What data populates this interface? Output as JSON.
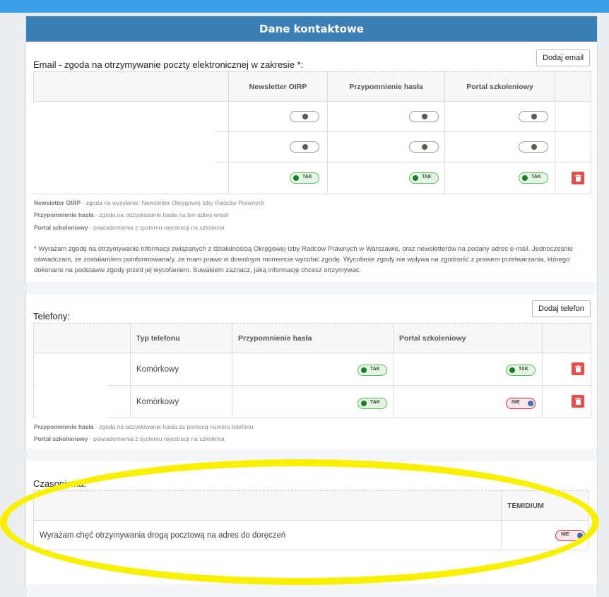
{
  "panel": {
    "title": "Dane kontaktowe"
  },
  "email": {
    "label": "Email - zgoda na otrzymywanie poczty elektronicznej w zakresie *:",
    "add_button": "Dodaj email",
    "columns": [
      "Newsletter OIRP",
      "Przypomnienie hasła",
      "Portal szkoleniowy"
    ],
    "rows": [
      {
        "newsletter": "off",
        "password": "off",
        "portal": "off"
      },
      {
        "newsletter": "off",
        "password": "off",
        "portal": "off"
      },
      {
        "newsletter": "TAK",
        "password": "TAK",
        "portal": "TAK"
      }
    ],
    "legend": [
      {
        "term": "Newsletter OIRP",
        "desc": " - zgoda na wysyłanie: Newsletter Okręgowej Izby Radców Prawnych"
      },
      {
        "term": "Przypomnienie hasła",
        "desc": " - zgoda na odzyskiwanie hasła na ten adres email"
      },
      {
        "term": "Portal szkoleniowy",
        "desc": " - powiadomienia z systemu rejestracji na szkolenia"
      }
    ],
    "note": "* Wyrażam zgodę na otrzymywanie informacji związanych z działalnością Okręgowej Izby Radców Prawnych w Warszawie, oraz newsletterów na podany adres e-mail. Jednocześnie oświadczam, że zostałam/em poinformowana/y, że mam prawo w dowolnym momencie wycofać zgodę. Wycofanie zgody nie wpływa na zgodność z prawem przetwarzania, którego dokonano na podstawie zgody przed jej wycofaniem. Suwakiem zaznacz, jaką informację chcesz otrzymywać."
  },
  "phones": {
    "label": "Telefony:",
    "add_button": "Dodaj telefon",
    "columns": [
      "Typ telefonu",
      "Przypomnienie hasła",
      "Portal szkoleniowy"
    ],
    "rows": [
      {
        "type": "Komórkowy",
        "password": "TAK",
        "portal": "TAK"
      },
      {
        "type": "Komórkowy",
        "password": "TAK",
        "portal": "NIE"
      }
    ],
    "legend": [
      {
        "term": "Przypomnienie hasła",
        "desc": " - zgoda na odzyskiwanie hasła za pomocą numeru telefonu"
      },
      {
        "term": "Portal szkoleniowy",
        "desc": " - powiadomienia z systemu rejestracji na szkolenia"
      }
    ]
  },
  "magazines": {
    "label": "Czasopisma:",
    "column": "TEMIDIUM",
    "row_text": "Wyrażam chęć otrzymywania drogą pocztową na adres do doręczeń",
    "value": "NIE"
  },
  "colors": {
    "header": "#3a80b6",
    "topbar": "#3b9ee8",
    "delete": "#e84c4c",
    "highlight": "#f8f000"
  }
}
